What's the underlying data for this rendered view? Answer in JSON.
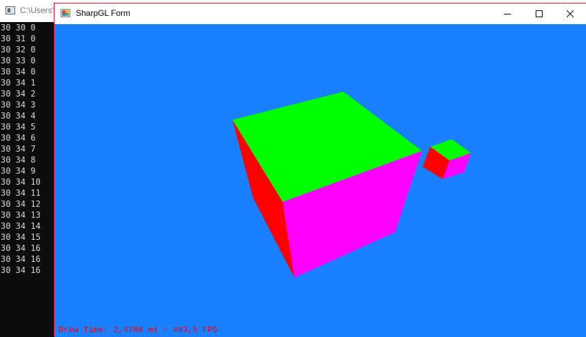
{
  "console": {
    "title": "C:\\Users\\",
    "lines": [
      "30 30 0",
      "30 31 0",
      "30 32 0",
      "30 33 0",
      "30 34 0",
      "30 34 1",
      "30 34 2",
      "30 34 3",
      "30 34 4",
      "30 34 5",
      "30 34 6",
      "30 34 7",
      "30 34 8",
      "30 34 9",
      "30 34 10",
      "30 34 11",
      "30 34 12",
      "30 34 13",
      "30 34 14",
      "30 34 15",
      "30 34 16",
      "30 34 16",
      "30 34 16"
    ]
  },
  "form": {
    "title": "SharpGL Form",
    "controls": {
      "minimize_icon": "minimize-icon",
      "maximize_icon": "maximize-icon",
      "close_icon": "close-icon"
    },
    "background_color": "#1a80ff",
    "status_text": "Draw Time: 2,4786 ms ~ 403,5 FPS",
    "status_color": "#e3001b",
    "cube_colors": {
      "top": "#00ff00",
      "left": "#ff0000",
      "right": "#ff00ff"
    }
  }
}
